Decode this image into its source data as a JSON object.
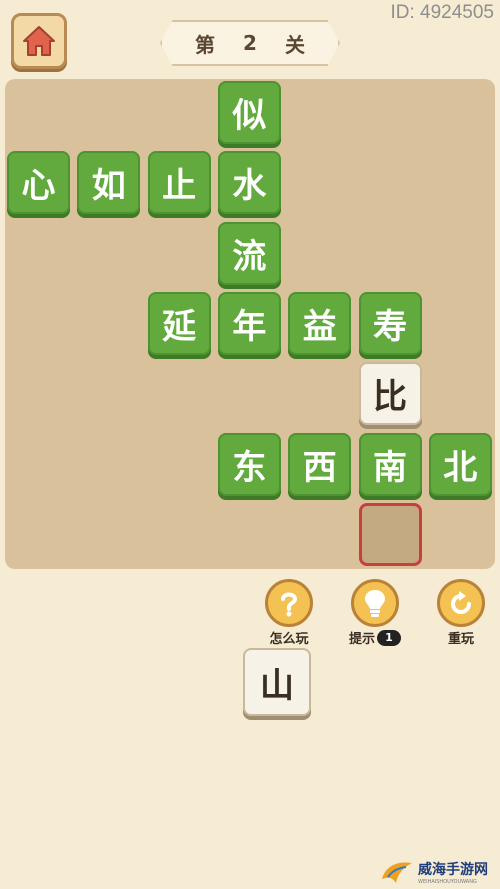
{
  "header": {
    "id_text": "ID: 4924505",
    "level": {
      "prefix": "第",
      "number": "2",
      "suffix": "关"
    }
  },
  "board": {
    "tiles": [
      {
        "char": "似",
        "row": 0,
        "col": 3,
        "state": "green"
      },
      {
        "char": "心",
        "row": 1,
        "col": 0,
        "state": "green"
      },
      {
        "char": "如",
        "row": 1,
        "col": 1,
        "state": "green"
      },
      {
        "char": "止",
        "row": 1,
        "col": 2,
        "state": "green"
      },
      {
        "char": "水",
        "row": 1,
        "col": 3,
        "state": "green"
      },
      {
        "char": "流",
        "row": 2,
        "col": 3,
        "state": "green"
      },
      {
        "char": "延",
        "row": 3,
        "col": 2,
        "state": "green"
      },
      {
        "char": "年",
        "row": 3,
        "col": 3,
        "state": "green"
      },
      {
        "char": "益",
        "row": 3,
        "col": 4,
        "state": "green"
      },
      {
        "char": "寿",
        "row": 3,
        "col": 5,
        "state": "green"
      },
      {
        "char": "比",
        "row": 4,
        "col": 5,
        "state": "white"
      },
      {
        "char": "东",
        "row": 5,
        "col": 3,
        "state": "green"
      },
      {
        "char": "西",
        "row": 5,
        "col": 4,
        "state": "green"
      },
      {
        "char": "南",
        "row": 5,
        "col": 5,
        "state": "green"
      },
      {
        "char": "北",
        "row": 5,
        "col": 6,
        "state": "green"
      },
      {
        "char": "",
        "row": 6,
        "col": 5,
        "state": "empty"
      }
    ]
  },
  "helpers": {
    "how_to_play": "怎么玩",
    "hint": "提示",
    "hint_count": "1",
    "replay": "重玩"
  },
  "candidates": [
    "山"
  ],
  "watermark": {
    "title": "威海手游网",
    "subtitle": "WEIHAISHOUYOUWANG"
  }
}
